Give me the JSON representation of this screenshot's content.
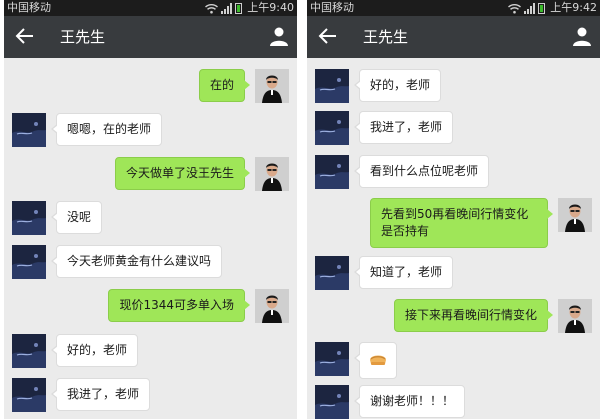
{
  "status_bar": {
    "carrier": "中国移动"
  },
  "left_screen": {
    "status_time": "上午9:40",
    "chat_title": "王先生",
    "messages": [
      {
        "side": "right",
        "text": "在的"
      },
      {
        "side": "left",
        "text": "嗯嗯，在的老师"
      },
      {
        "side": "right",
        "text": "今天做单了没王先生"
      },
      {
        "side": "left",
        "text": "没呢"
      },
      {
        "side": "left",
        "text": "今天老师黄金有什么建议吗"
      },
      {
        "side": "right",
        "text": "现价1344可多单入场"
      },
      {
        "side": "left",
        "text": "好的，老师"
      },
      {
        "side": "left",
        "text": "我进了，老师"
      }
    ]
  },
  "right_screen": {
    "status_time": "上午9:42",
    "chat_title": "王先生",
    "messages": [
      {
        "side": "left",
        "text": "好的，老师"
      },
      {
        "side": "left",
        "text": "我进了，老师"
      },
      {
        "side": "left",
        "text": "看到什么点位呢老师"
      },
      {
        "side": "right",
        "text": "先看到50再看晚间行情变化是否持有"
      },
      {
        "side": "left",
        "text": "知道了，老师"
      },
      {
        "side": "right",
        "text": "接下来再看晚间行情变化"
      },
      {
        "side": "left",
        "emoji": "bread-emoji"
      },
      {
        "side": "left",
        "text": "谢谢老师！！！"
      }
    ]
  },
  "colors": {
    "title_bar": "#383b3e",
    "chat_background": "#ebebeb",
    "sent_bubble": "#9fe658",
    "received_bubble": "#ffffff"
  }
}
